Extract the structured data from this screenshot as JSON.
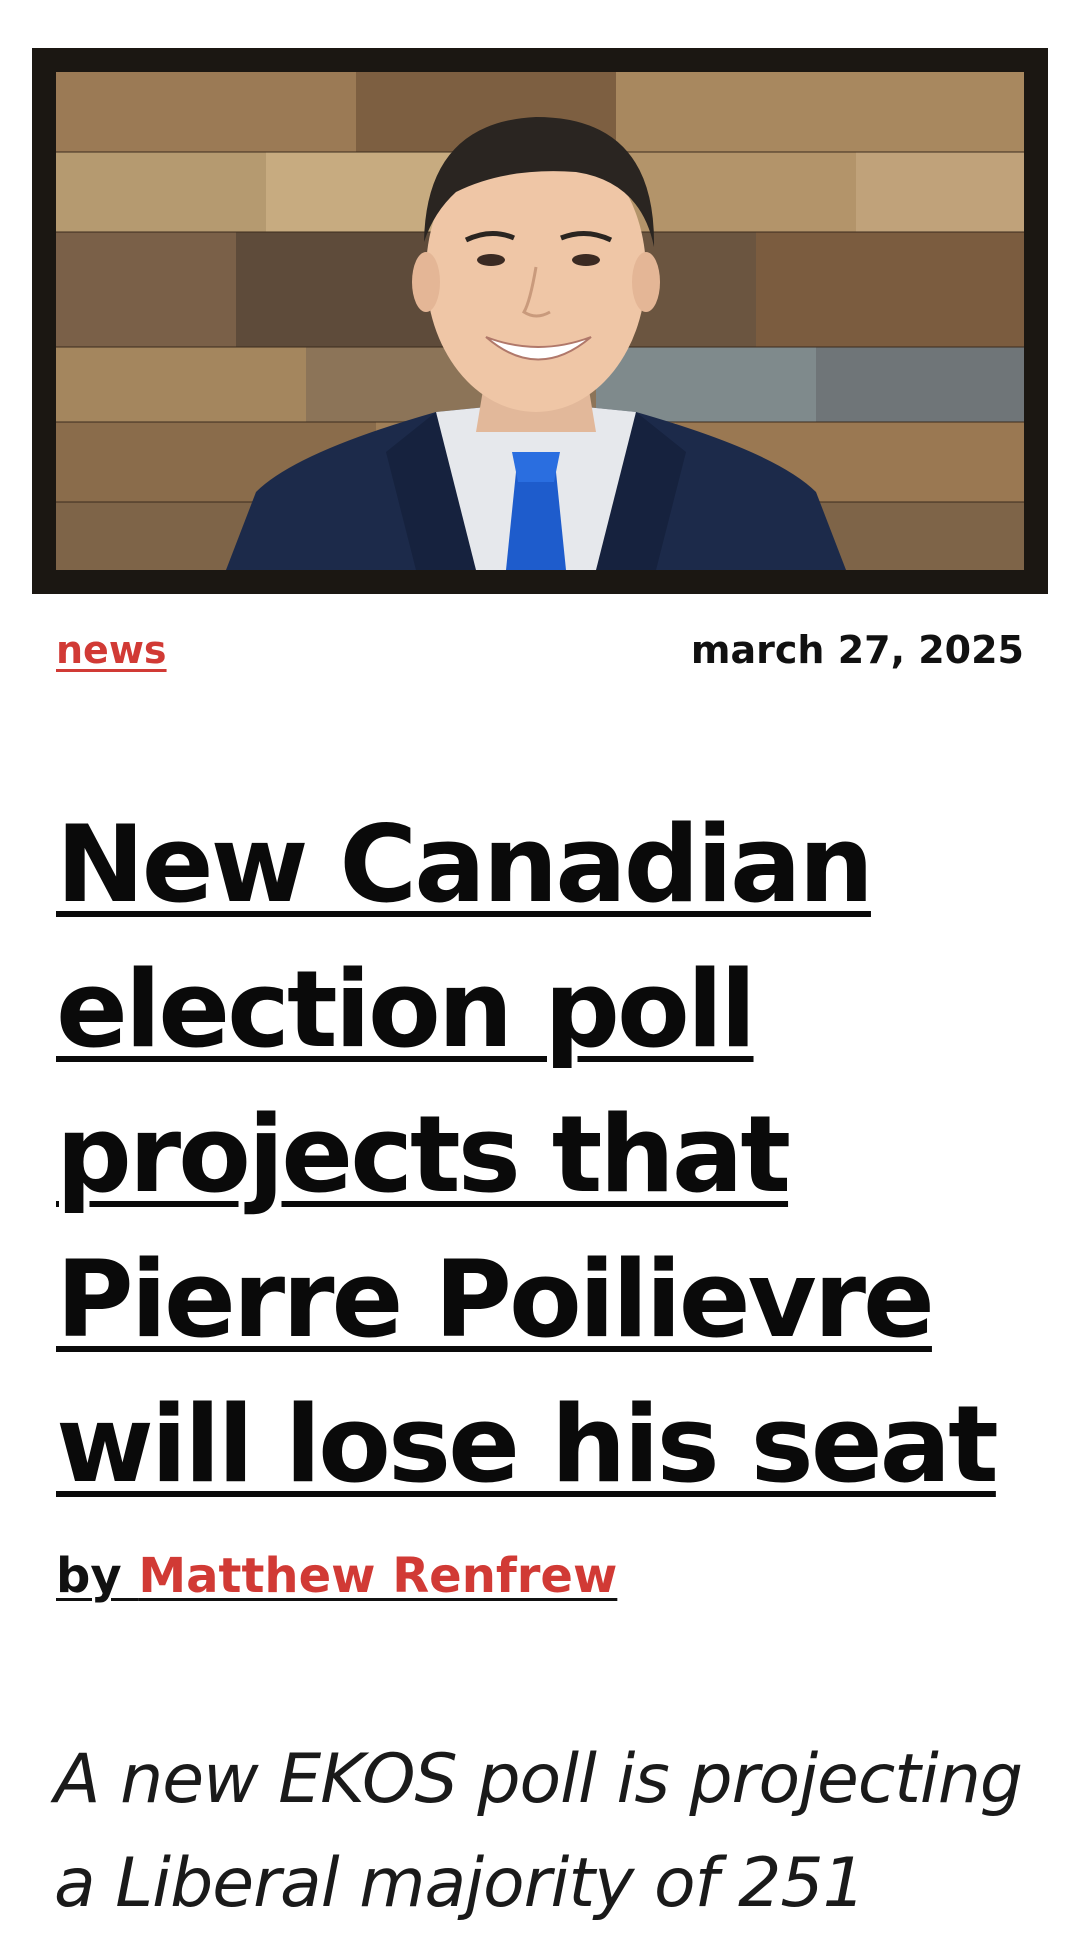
{
  "hero": {
    "image_alt": "Pierre Poilievre smiling in front of a wood-panel wall",
    "subject": "portrait-photo"
  },
  "meta": {
    "category": "news",
    "date": "march 27, 2025"
  },
  "article": {
    "headline": "New Canadian election poll projects that Pierre Poilievre will lose his seat",
    "byline_prefix": "by ",
    "author": "Matthew Renfrew",
    "dek": "A new EKOS poll is projecting a Liberal majority of 251"
  },
  "colors": {
    "accent": "#d13a35",
    "text": "#111111",
    "background": "#ffffff"
  }
}
